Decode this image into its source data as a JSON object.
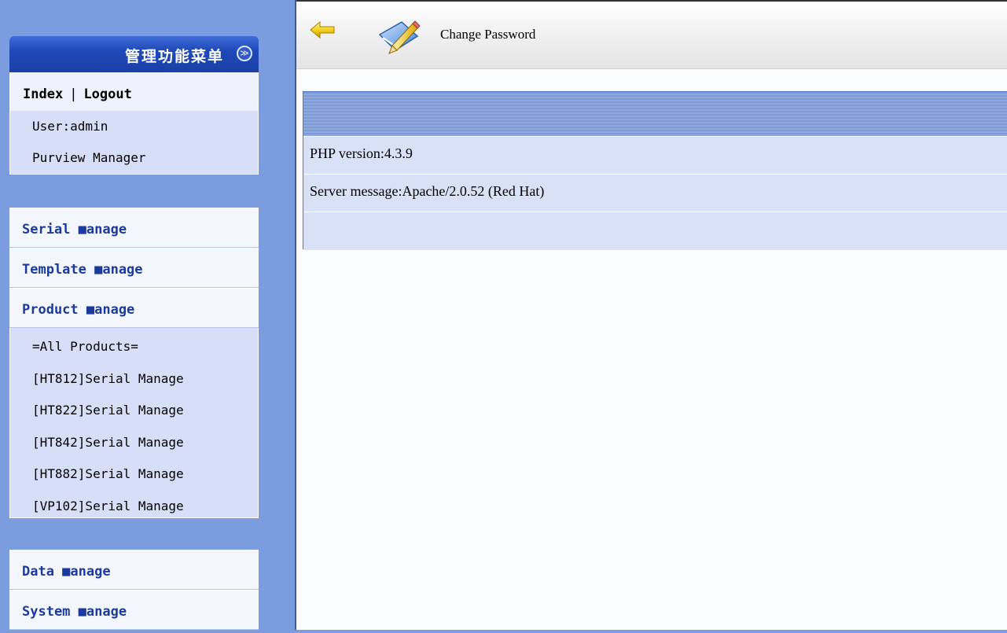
{
  "sidebar": {
    "panel_title": "管理功能菜单",
    "collapse_glyph": "≫",
    "index_link": "Index",
    "separator": "|",
    "logout_link": "Logout",
    "user_label": "User:admin",
    "purview_label": "Purview Manager",
    "sections": {
      "serial": "Serial ■anage",
      "template": "Template ■anage",
      "product": "Product ■anage",
      "data": "Data ■anage",
      "system": "System ■anage"
    },
    "product_items": [
      "=All Products=",
      "[HT812]Serial Manage",
      "[HT822]Serial Manage",
      "[HT842]Serial Manage",
      "[HT882]Serial Manage",
      "[VP102]Serial Manage"
    ]
  },
  "toolbar": {
    "change_password_label": "Change Password",
    "back_icon": "back-arrow-icon",
    "password_icon": "edit-pencil-icon"
  },
  "info": {
    "php_version": "PHP version:4.3.9",
    "server_message": "Server message:Apache/2.0.52 (Red Hat)"
  }
}
